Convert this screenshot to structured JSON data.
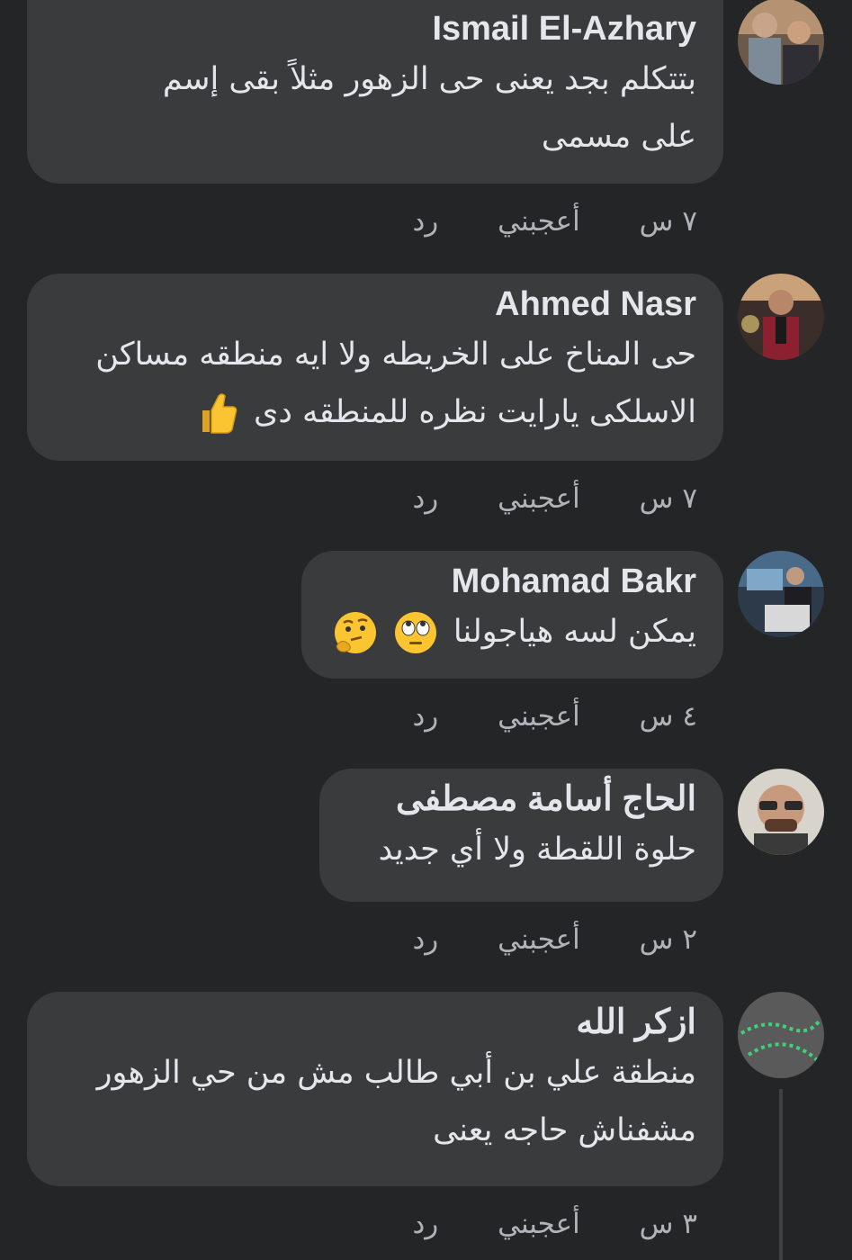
{
  "comments": [
    {
      "author": "Ismail El-Azhary",
      "lines": [
        "بتتكلم بجد يعنى حى الزهور مثلاً بقى إسم",
        "على مسمى"
      ],
      "time": "٧ س",
      "like": "أعجبني",
      "reply": "رد",
      "avatar_icon": "profile-photo"
    },
    {
      "author": "Ahmed Nasr",
      "lines": [
        "حى المناخ على الخريطه ولا ايه منطقه مساكن",
        "الاسلكى يارايت نظره للمنطقه دى"
      ],
      "emoji": [
        "thumbs-up"
      ],
      "time": "٧ س",
      "like": "أعجبني",
      "reply": "رد",
      "avatar_icon": "profile-photo"
    },
    {
      "author": "Mohamad Bakr",
      "lines": [
        "يمكن لسه هياجولنا"
      ],
      "emoji": [
        "face-with-rolling-eyes",
        "thinking-face"
      ],
      "time": "٤ س",
      "like": "أعجبني",
      "reply": "رد",
      "avatar_icon": "profile-photo"
    },
    {
      "author": "الحاج أسامة مصطفى",
      "lines": [
        "حلوة اللقطة  ولا أي جديد"
      ],
      "time": "٢ س",
      "like": "أعجبني",
      "reply": "رد",
      "avatar_icon": "profile-photo"
    },
    {
      "author": "ازكر الله",
      "lines": [
        "منطقة علي بن أبي طالب مش من حي الزهور",
        "مشفناش حاجه يعنى"
      ],
      "time": "٣ س",
      "like": "أعجبني",
      "reply": "رد",
      "avatar_icon": "prayer-beads"
    }
  ],
  "colors": {
    "background": "#242526",
    "bubble": "#3a3b3c",
    "text": "#e4e6eb",
    "meta": "#b0b3b8"
  }
}
